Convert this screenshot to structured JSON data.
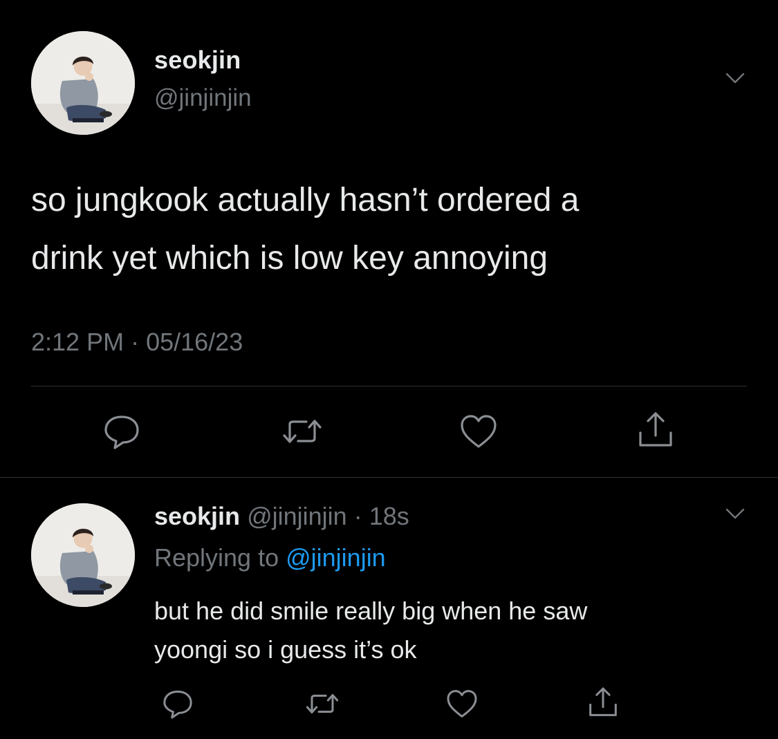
{
  "main_tweet": {
    "name": "seokjin",
    "handle": "@jinjinjin",
    "text_line1": "so jungkook actually hasn’t ordered a",
    "text_line2": "drink yet which is low key annoying",
    "time": "2:12 PM",
    "separator": " · ",
    "date": "05/16/23"
  },
  "reply_tweet": {
    "name": "seokjin",
    "handle": "@jinjinjin",
    "separator": " · ",
    "time_ago": "18s",
    "replying_prefix": "Replying to ",
    "replying_to": "@jinjinjin",
    "text_line1": "but he did smile really big when he saw",
    "text_line2": "yoongi so i guess it’s ok"
  },
  "icons": {
    "menu": "chevron-down-icon",
    "reply": "reply-bubble-icon",
    "retweet": "retweet-icon",
    "like": "heart-icon",
    "share": "share-icon"
  },
  "colors": {
    "background": "#000000",
    "text": "#e7e9ea",
    "muted": "#71767b",
    "link": "#1d9bf0",
    "divider": "#2f3336"
  }
}
